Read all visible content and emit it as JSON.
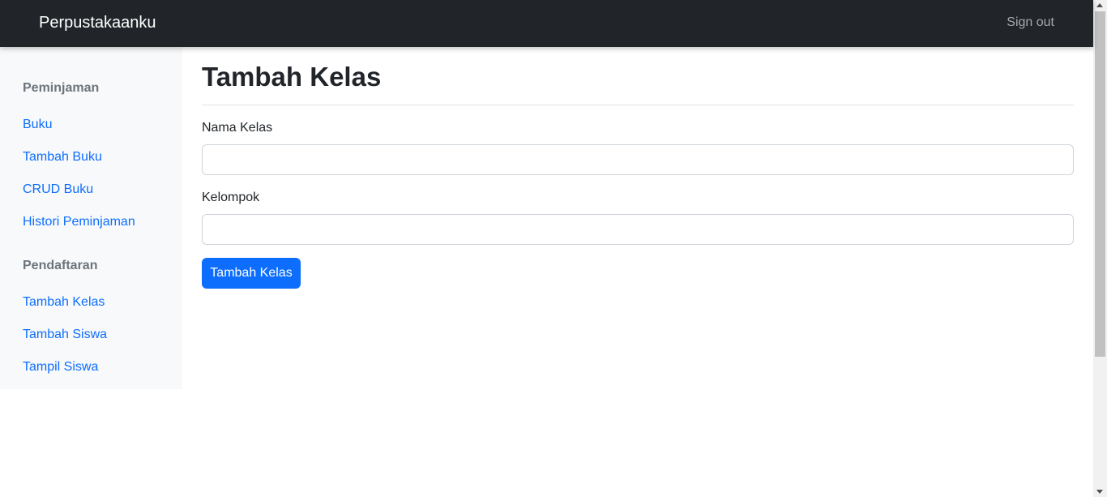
{
  "navbar": {
    "brand": "Perpustakaanku",
    "signout": "Sign out"
  },
  "sidebar": {
    "sections": [
      {
        "heading": "Peminjaman",
        "items": [
          "Buku",
          "Tambah Buku",
          "CRUD Buku",
          "Histori Peminjaman"
        ]
      },
      {
        "heading": "Pendaftaran",
        "items": [
          "Tambah Kelas",
          "Tambah Siswa",
          "Tampil Siswa"
        ]
      }
    ]
  },
  "main": {
    "title": "Tambah Kelas",
    "fields": [
      {
        "label": "Nama Kelas",
        "value": "",
        "placeholder": ""
      },
      {
        "label": "Kelompok",
        "value": "",
        "placeholder": ""
      }
    ],
    "submit_label": "Tambah Kelas"
  },
  "colors": {
    "navbar_bg": "#212529",
    "link": "#0d6efd",
    "primary_button": "#0d6efd",
    "sidebar_bg": "#f8f9fa"
  }
}
